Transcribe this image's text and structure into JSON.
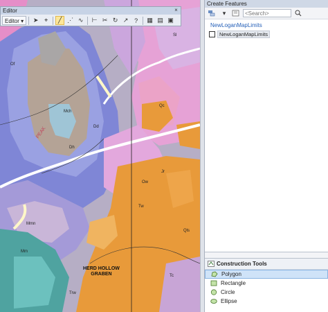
{
  "editor": {
    "title": "Editor",
    "menu_label": "Editor ▾",
    "close_glyph": "×",
    "tools": [
      {
        "name": "edit-tool-icon",
        "glyph": "➤"
      },
      {
        "name": "edit-annotation-icon",
        "glyph": "⌖"
      },
      {
        "name": "straight-segment-icon",
        "glyph": "╱"
      },
      {
        "name": "vertex-icon",
        "glyph": "⋰"
      },
      {
        "name": "trace-icon",
        "glyph": "∿"
      },
      {
        "name": "split-icon",
        "glyph": "⊢"
      },
      {
        "name": "cut-polygon-icon",
        "glyph": "✂"
      },
      {
        "name": "rotate-icon",
        "glyph": "↻"
      },
      {
        "name": "reshape-icon",
        "glyph": "↗"
      },
      {
        "name": "help-icon",
        "glyph": "?"
      },
      {
        "name": "attributes-icon",
        "glyph": "▦"
      },
      {
        "name": "sketch-properties-icon",
        "glyph": "▤"
      },
      {
        "name": "create-features-icon",
        "glyph": "▣"
      }
    ]
  },
  "panel": {
    "title": "Create Features",
    "search_placeholder": "<Search>",
    "group_header": "NewLoganMapLimits",
    "template_label": "NewLoganMapLimits",
    "construction": {
      "title": "Construction Tools",
      "items": [
        {
          "label": "Polygon",
          "icon": "polygon-icon"
        },
        {
          "label": "Rectangle",
          "icon": "rectangle-icon"
        },
        {
          "label": "Circle",
          "icon": "circle-icon"
        },
        {
          "label": "Ellipse",
          "icon": "ellipse-icon"
        }
      ]
    }
  },
  "map": {
    "graben_label": "HERD HOLLOW\nGRABEN",
    "peak_label": "PEAK",
    "unit_labels": [
      "Mm",
      "Mmn",
      "Dh",
      "Ow",
      "Qc",
      "Tw",
      "Sl",
      "Dd",
      "Jr",
      "Mch",
      "Tc",
      "Trw",
      "Of",
      "Qls"
    ]
  }
}
